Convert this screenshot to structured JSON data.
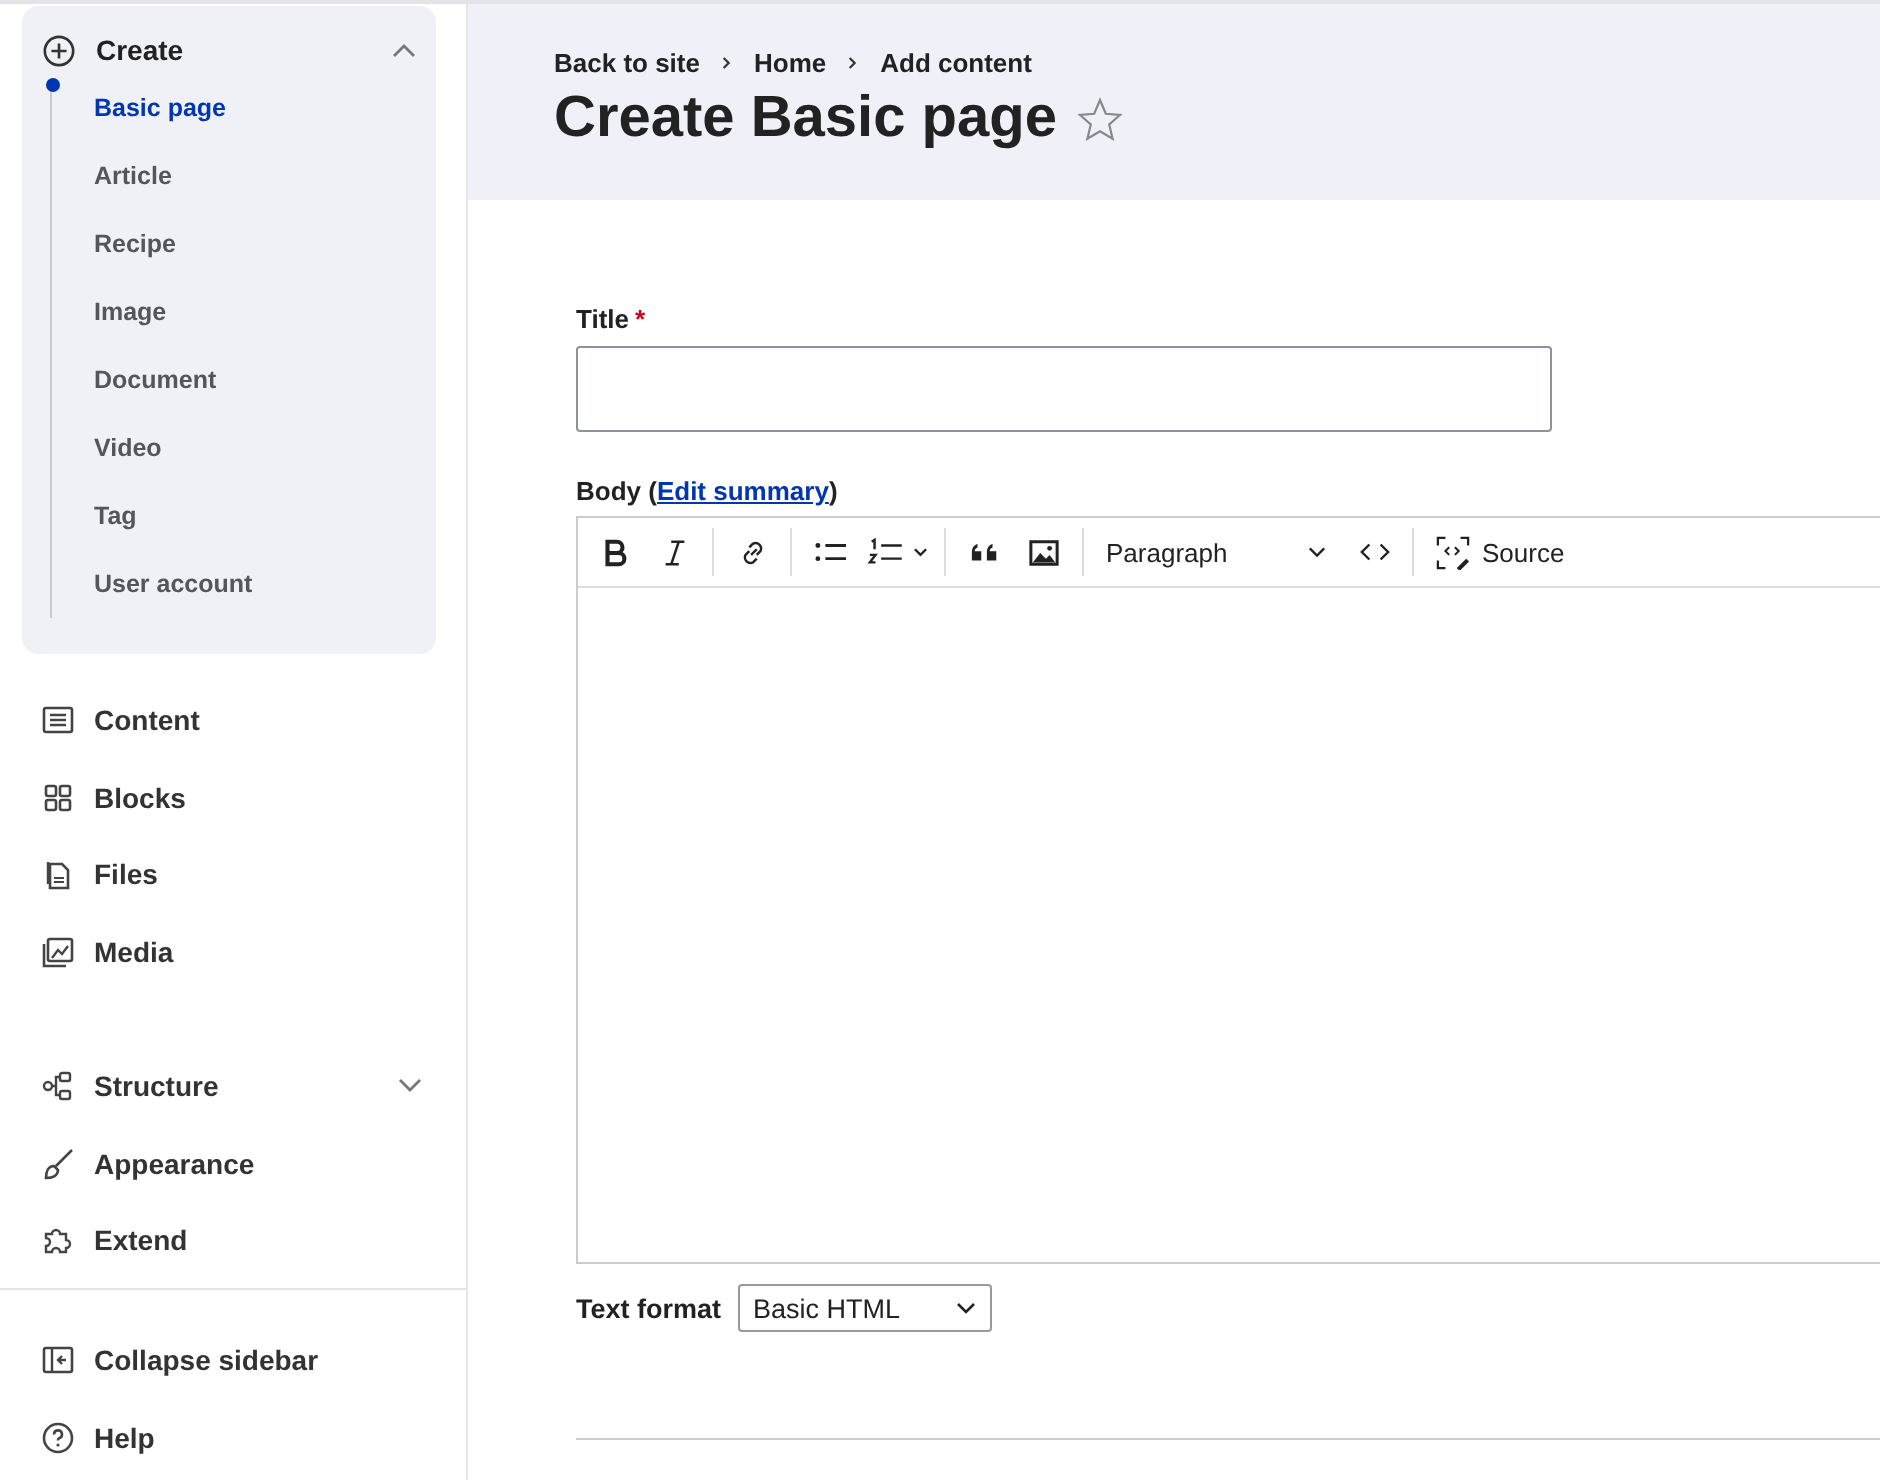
{
  "sidebar": {
    "create": {
      "label": "Create",
      "expanded": true,
      "items": [
        {
          "label": "Basic page",
          "selected": true
        },
        {
          "label": "Article",
          "selected": false
        },
        {
          "label": "Recipe",
          "selected": false
        },
        {
          "label": "Image",
          "selected": false
        },
        {
          "label": "Document",
          "selected": false
        },
        {
          "label": "Video",
          "selected": false
        },
        {
          "label": "Tag",
          "selected": false
        },
        {
          "label": "User account",
          "selected": false
        }
      ]
    },
    "group_1": [
      {
        "label": "Content"
      },
      {
        "label": "Blocks"
      },
      {
        "label": "Files"
      },
      {
        "label": "Media"
      }
    ],
    "group_2": [
      {
        "label": "Structure",
        "expanded": false
      },
      {
        "label": "Appearance"
      },
      {
        "label": "Extend"
      }
    ],
    "footer": [
      {
        "label": "Collapse sidebar"
      },
      {
        "label": "Help"
      }
    ]
  },
  "header": {
    "breadcrumb": [
      "Back to site",
      "Home",
      "Add content"
    ],
    "title": "Create Basic page"
  },
  "form": {
    "title_field": {
      "label": "Title",
      "required_mark": "*"
    },
    "body": {
      "label_before": "Body (",
      "link": "Edit summary",
      "label_after": ")",
      "toolbar": [
        {
          "kind": "bold"
        },
        {
          "kind": "italic"
        },
        {
          "kind": "sep"
        },
        {
          "kind": "link"
        },
        {
          "kind": "sep"
        },
        {
          "kind": "bullets"
        },
        {
          "kind": "numbers"
        },
        {
          "kind": "sep"
        },
        {
          "kind": "quote"
        },
        {
          "kind": "image"
        },
        {
          "kind": "sep"
        },
        {
          "kind": "heading",
          "value": "Paragraph"
        },
        {
          "kind": "code"
        },
        {
          "kind": "sep"
        },
        {
          "kind": "source",
          "label": "Source"
        }
      ]
    },
    "text_format": {
      "label": "Text format",
      "value": "Basic HTML"
    }
  }
}
